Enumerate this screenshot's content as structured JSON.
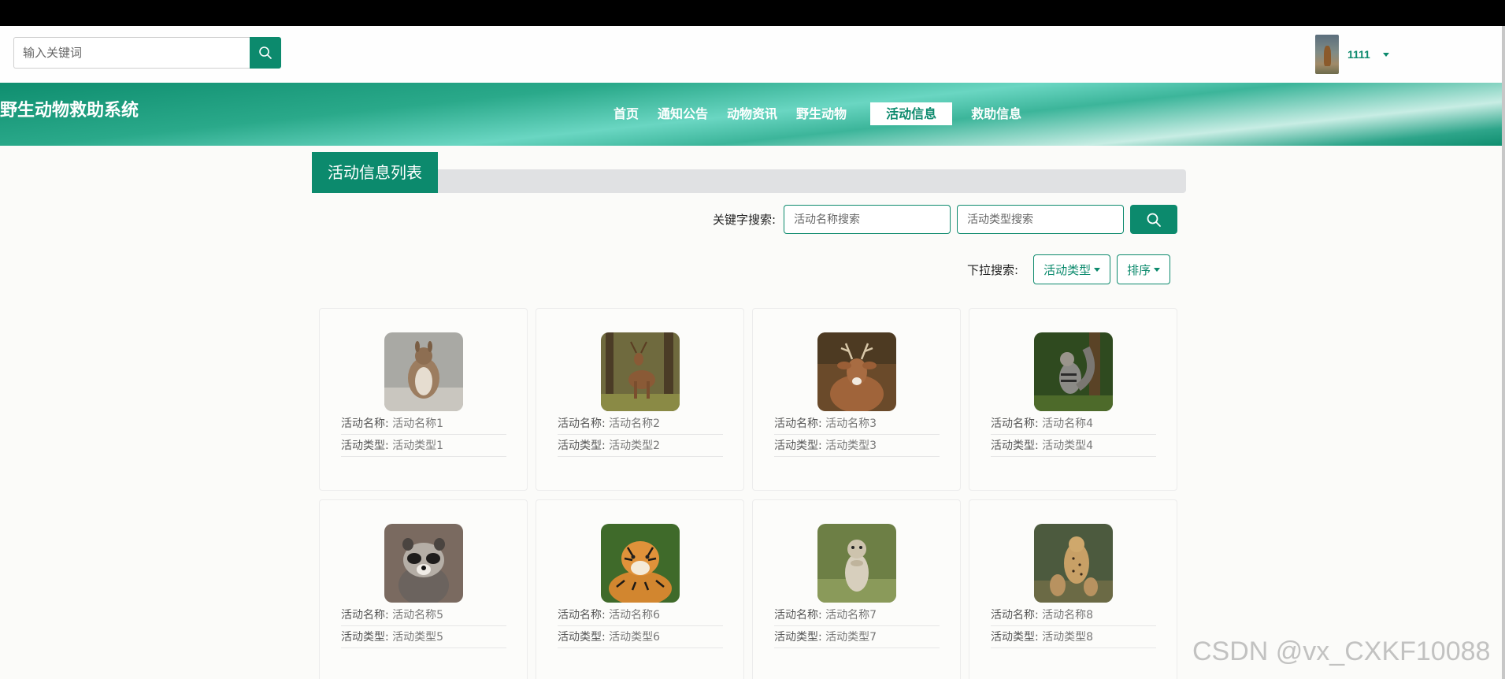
{
  "header": {
    "search_placeholder": "输入关键词",
    "username": "1111"
  },
  "nav": {
    "site_title": "野生动物救助系统",
    "items": [
      "首页",
      "通知公告",
      "动物资讯",
      "野生动物",
      "活动信息",
      "救助信息"
    ],
    "active": "活动信息"
  },
  "list": {
    "title": "活动信息列表",
    "keyword_label": "关键字搜索:",
    "name_placeholder": "活动名称搜索",
    "type_placeholder": "活动类型搜索",
    "dropdown_label": "下拉搜索:",
    "type_dropdown": "活动类型",
    "sort_dropdown": "排序"
  },
  "cards": [
    {
      "name_key": "活动名称:",
      "name": "活动名称1",
      "type_key": "活动类型:",
      "type": "活动类型1",
      "image": "wallaby"
    },
    {
      "name_key": "活动名称:",
      "name": "活动名称2",
      "type_key": "活动类型:",
      "type": "活动类型2",
      "image": "deer"
    },
    {
      "name_key": "活动名称:",
      "name": "活动名称3",
      "type_key": "活动类型:",
      "type": "活动类型3",
      "image": "deer-buck"
    },
    {
      "name_key": "活动名称:",
      "name": "活动名称4",
      "type_key": "活动类型:",
      "type": "活动类型4",
      "image": "squirrel"
    },
    {
      "name_key": "活动名称:",
      "name": "活动名称5",
      "type_key": "活动类型:",
      "type": "活动类型5",
      "image": "raccoon"
    },
    {
      "name_key": "活动名称:",
      "name": "活动名称6",
      "type_key": "活动类型:",
      "type": "活动类型6",
      "image": "tiger"
    },
    {
      "name_key": "活动名称:",
      "name": "活动名称7",
      "type_key": "活动类型:",
      "type": "活动类型7",
      "image": "prairie-dog"
    },
    {
      "name_key": "活动名称:",
      "name": "活动名称8",
      "type_key": "活动类型:",
      "type": "活动类型8",
      "image": "cheetah"
    }
  ],
  "watermark": "CSDN @vx_CXKF10088",
  "colors": {
    "primary": "#0c8a6d",
    "nav_light": "#6ad6c2",
    "topbar": "#000000"
  }
}
